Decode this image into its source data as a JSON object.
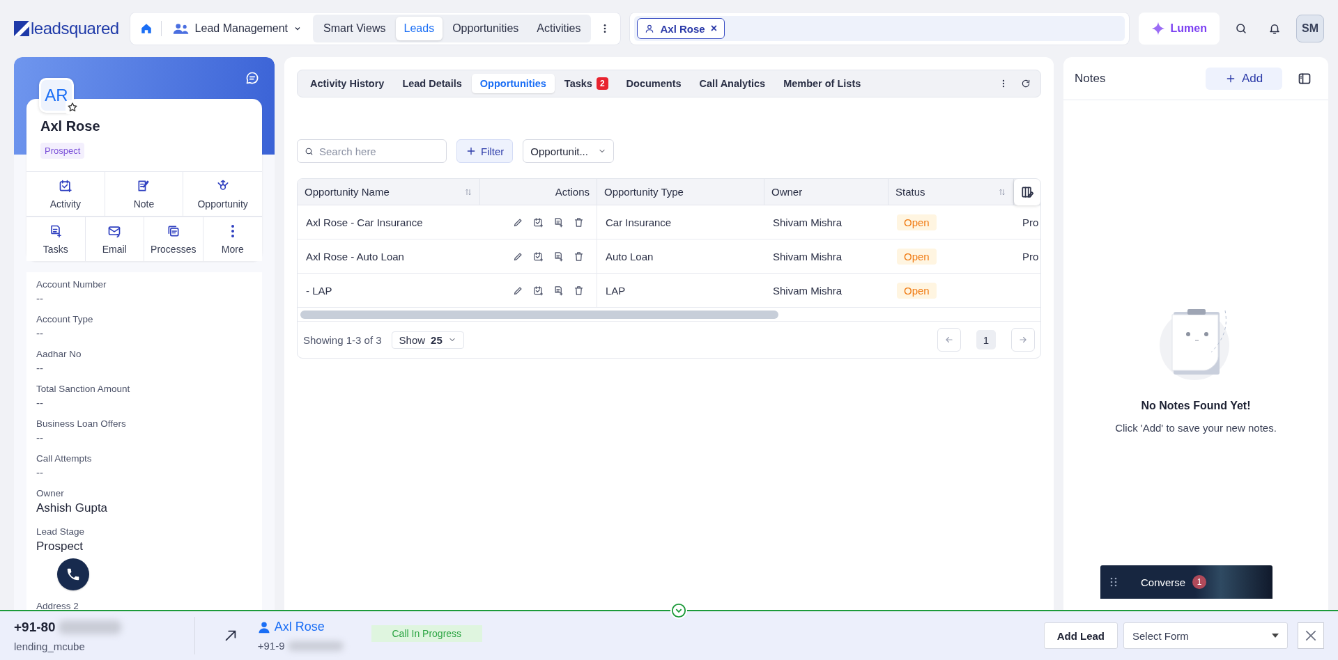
{
  "header": {
    "logo": "leadsquared",
    "module": "Lead Management",
    "nav": [
      {
        "label": "Smart Views",
        "selected": false
      },
      {
        "label": "Leads",
        "selected": true
      },
      {
        "label": "Opportunities",
        "selected": false
      },
      {
        "label": "Activities",
        "selected": false
      }
    ],
    "open_tabs": [
      {
        "label": "Axl Rose",
        "close": "×"
      }
    ],
    "lumen": "Lumen",
    "avatar": "SM"
  },
  "lead": {
    "initials": "AR",
    "name": "Axl Rose",
    "stage_tag": "Prospect",
    "actions_top": [
      "Activity",
      "Note",
      "Opportunity"
    ],
    "actions_bottom": [
      "Tasks",
      "Email",
      "Processes",
      "More"
    ],
    "fields": [
      {
        "label": "Account Number",
        "value": "--",
        "kind": "empty"
      },
      {
        "label": "Account Type",
        "value": "--",
        "kind": "empty"
      },
      {
        "label": "Aadhar No",
        "value": "--",
        "kind": "empty"
      },
      {
        "label": "Total Sanction Amount",
        "value": "--",
        "kind": "empty"
      },
      {
        "label": "Business Loan Offers",
        "value": "--",
        "kind": "empty"
      },
      {
        "label": "Call Attempts",
        "value": "--",
        "kind": "empty"
      },
      {
        "label": "Owner",
        "value": "Ashish Gupta",
        "kind": "filled"
      },
      {
        "label": "Lead Stage",
        "value": "Prospect",
        "kind": "filled"
      },
      {
        "label": "Address 2"
      }
    ]
  },
  "detail_tabs": [
    {
      "label": "Activity History",
      "selected": false
    },
    {
      "label": "Lead Details",
      "selected": false
    },
    {
      "label": "Opportunities",
      "selected": true
    },
    {
      "label": "Tasks",
      "selected": false,
      "badge": "2"
    },
    {
      "label": "Documents",
      "selected": false
    },
    {
      "label": "Call Analytics",
      "selected": false
    },
    {
      "label": "Member of Lists",
      "selected": false
    }
  ],
  "toolbar": {
    "search_placeholder": "Search here",
    "filter": "Filter",
    "view": "Opportunit..."
  },
  "table": {
    "columns": [
      {
        "label": "Opportunity Name",
        "sortable": true
      },
      {
        "label": "Actions",
        "sortable": false
      },
      {
        "label": "Opportunity Type",
        "sortable": false
      },
      {
        "label": "Owner",
        "sortable": false
      },
      {
        "label": "Status",
        "sortable": true
      }
    ],
    "rows": [
      {
        "name": "Axl Rose - Car Insurance",
        "type": "Car Insurance",
        "owner": "Shivam Mishra",
        "status": "Open",
        "column_6": "Pro"
      },
      {
        "name": "Axl Rose - Auto Loan",
        "type": "Auto Loan",
        "owner": "Shivam Mishra",
        "status": "Open",
        "column_6": "Pro"
      },
      {
        "name": "- LAP",
        "type": "LAP",
        "owner": "Shivam Mishra",
        "status": "Open"
      }
    ],
    "showing": "Showing 1-3 of 3",
    "show_label": "Show",
    "show_count": "25",
    "page": "1"
  },
  "notes": {
    "title": "Notes",
    "add": "Add",
    "empty_title": "No Notes Found Yet!",
    "empty_text": "Click 'Add' to save your new notes."
  },
  "converse": {
    "label": "Converse",
    "badge": "1"
  },
  "call_bar": {
    "number": "+91-80",
    "account": "lending_mcube",
    "contact": "Axl Rose",
    "contact_number": "+91-9",
    "status": "Call In Progress",
    "add_lead": "Add Lead",
    "select_placeholder": "Select Form"
  }
}
